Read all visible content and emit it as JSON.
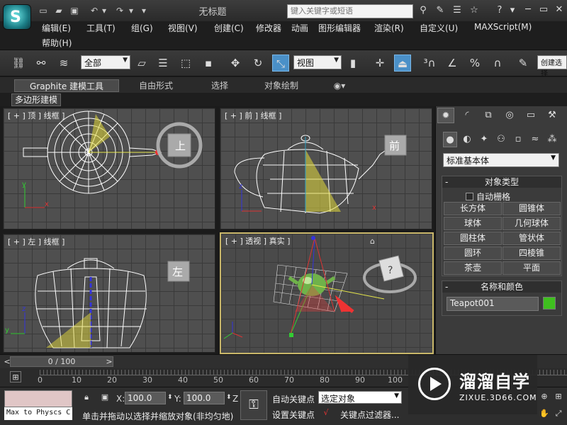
{
  "window": {
    "title": "无标题",
    "logo_letter": "S"
  },
  "search": {
    "placeholder": "键入关键字或短语"
  },
  "menu": {
    "items": [
      "编辑(E)",
      "工具(T)",
      "组(G)",
      "视图(V)",
      "创建(C)",
      "修改器",
      "动画",
      "图形编辑器",
      "渲染(R)",
      "自定义(U)",
      "MAXScript(M)",
      "帮助(H)"
    ]
  },
  "toolbar": {
    "filter_value": "全部",
    "refcoord_value": "视图",
    "create_set_value": "创建选择"
  },
  "ribbon": {
    "tabs": [
      "Graphite 建模工具",
      "自由形式",
      "选择",
      "对象绘制"
    ],
    "subtab": "多边形建模"
  },
  "viewports": {
    "top": {
      "label": "[ + ] 顶 ] 线框 ]",
      "cube": "上"
    },
    "front": {
      "label": "[ + ] 前 ] 线框 ]",
      "cube": "前"
    },
    "left": {
      "label": "[ + ] 左 ] 线框 ]",
      "cube": "左"
    },
    "persp": {
      "label": "[ + ] 透视 ] 真实 ]"
    },
    "axis_x": "x",
    "axis_y": "y",
    "axis_z": "z"
  },
  "command_panel": {
    "dropdown_value": "标准基本体",
    "object_type": {
      "title": "对象类型",
      "autogrid": "自动栅格",
      "buttons": [
        "长方体",
        "圆锥体",
        "球体",
        "几何球体",
        "圆柱体",
        "管状体",
        "圆环",
        "四棱锥",
        "茶壶",
        "平面"
      ]
    },
    "name_color": {
      "title": "名称和颜色",
      "name": "Teapot001",
      "color": "#3fbf1f"
    }
  },
  "timeline": {
    "slider": "0 / 100",
    "ticks": [
      "0",
      "10",
      "20",
      "30",
      "40",
      "50",
      "60",
      "70",
      "80",
      "90",
      "100"
    ]
  },
  "status": {
    "maxscript": "Max to Physcs C",
    "x_label": "X:",
    "x_value": "100.0",
    "y_label": "Y:",
    "y_value": "100.0",
    "z_label": "Z",
    "prompt": "单击并拖动以选择并缩放对象(非均匀地)",
    "auto_key": "自动关键点",
    "set_key": "设置关键点",
    "selection_set": "选定对象",
    "key_filters": "关键点过滤器..."
  },
  "watermark": {
    "title": "溜溜自学",
    "sub": "ZIXUE.3D66.COM"
  }
}
